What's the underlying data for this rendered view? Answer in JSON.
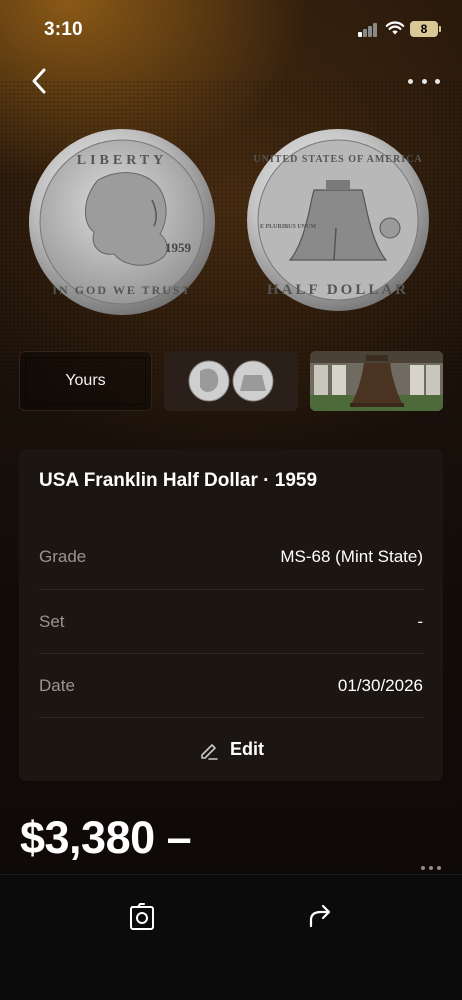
{
  "status_bar": {
    "time": "3:10",
    "battery": "8"
  },
  "nav": {
    "back_icon": "chevron-left-icon",
    "more_icon": "ellipsis-icon"
  },
  "coin_images": {
    "front": {
      "top_text": "LIBERTY",
      "year": "1959",
      "bottom_text": "IN GOD WE TRUST"
    },
    "back": {
      "top_text": "UNITED STATES OF AMERICA",
      "motto": "E PLURIBUS UNUM",
      "bottom_text": "HALF DOLLAR"
    }
  },
  "thumbnails": [
    {
      "label": "Yours"
    },
    {
      "label": ""
    },
    {
      "label": ""
    }
  ],
  "details": {
    "title": "USA Franklin Half Dollar · 1959",
    "rows": [
      {
        "label": "Grade",
        "value": "MS-68 (Mint State)"
      },
      {
        "label": "Set",
        "value": "-"
      },
      {
        "label": "Date",
        "value": "01/30/2026"
      }
    ],
    "edit_label": "Edit"
  },
  "price": "$3,380 –",
  "colors": {
    "accent_gold": "#d9c796",
    "card_bg": "#1c1612",
    "muted_text": "#9b948e"
  }
}
